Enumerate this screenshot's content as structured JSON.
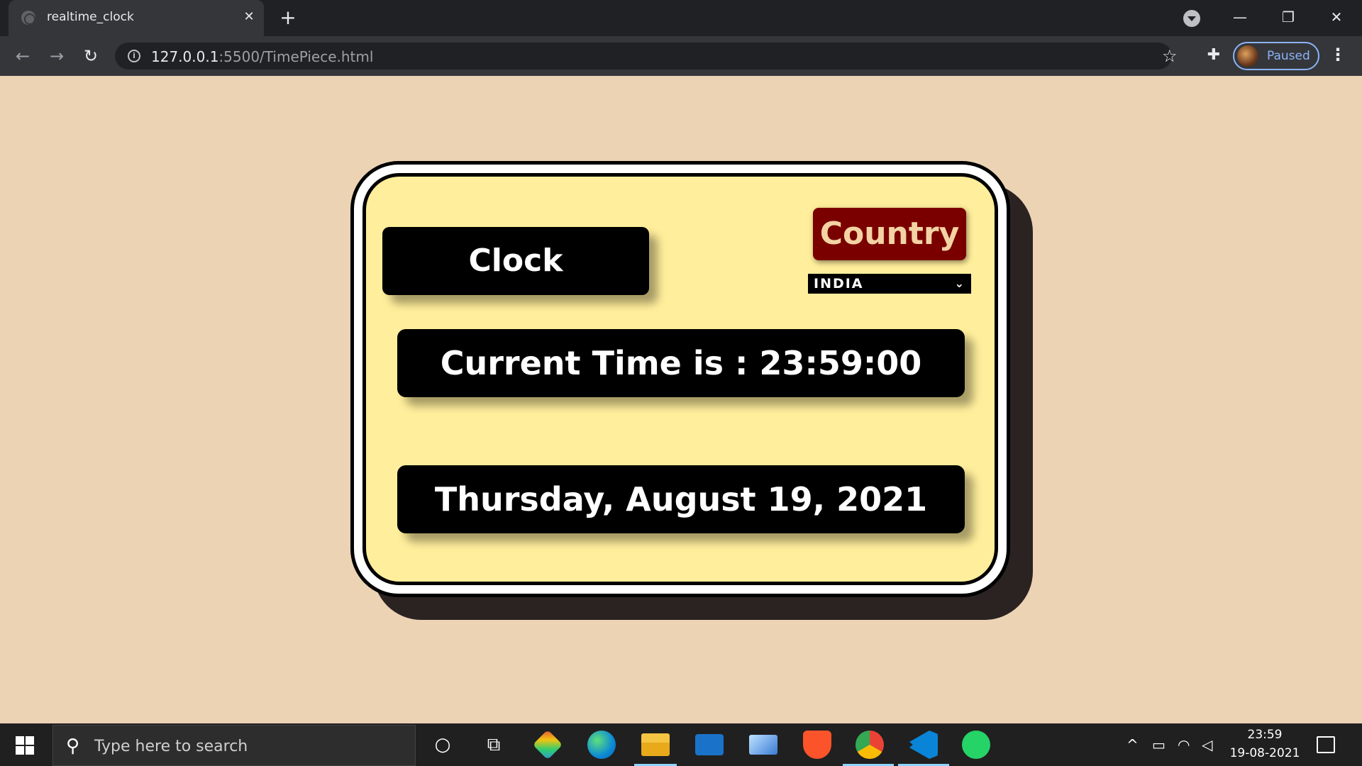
{
  "browser": {
    "tab_title": "realtime_clock",
    "tab_close": "✕",
    "new_tab": "+",
    "url_host": "127.0.0.1",
    "url_rest": ":5500/TimePiece.html",
    "profile_label": "Paused",
    "window_controls": {
      "minimize": "—",
      "restore": "❐",
      "close": "✕"
    }
  },
  "clock": {
    "title": "Clock",
    "country_label": "Country",
    "country_selected": "INDIA",
    "time_text": "Current Time is : 23:59:00",
    "date_text": "Thursday, August 19, 2021"
  },
  "taskbar": {
    "search_placeholder": "Type here to search",
    "time": "23:59",
    "date": "19-08-2021"
  },
  "colors": {
    "page_bg": "#ebd3b4",
    "card_bg": "#ffee9b",
    "country_bg": "#7a0000"
  }
}
